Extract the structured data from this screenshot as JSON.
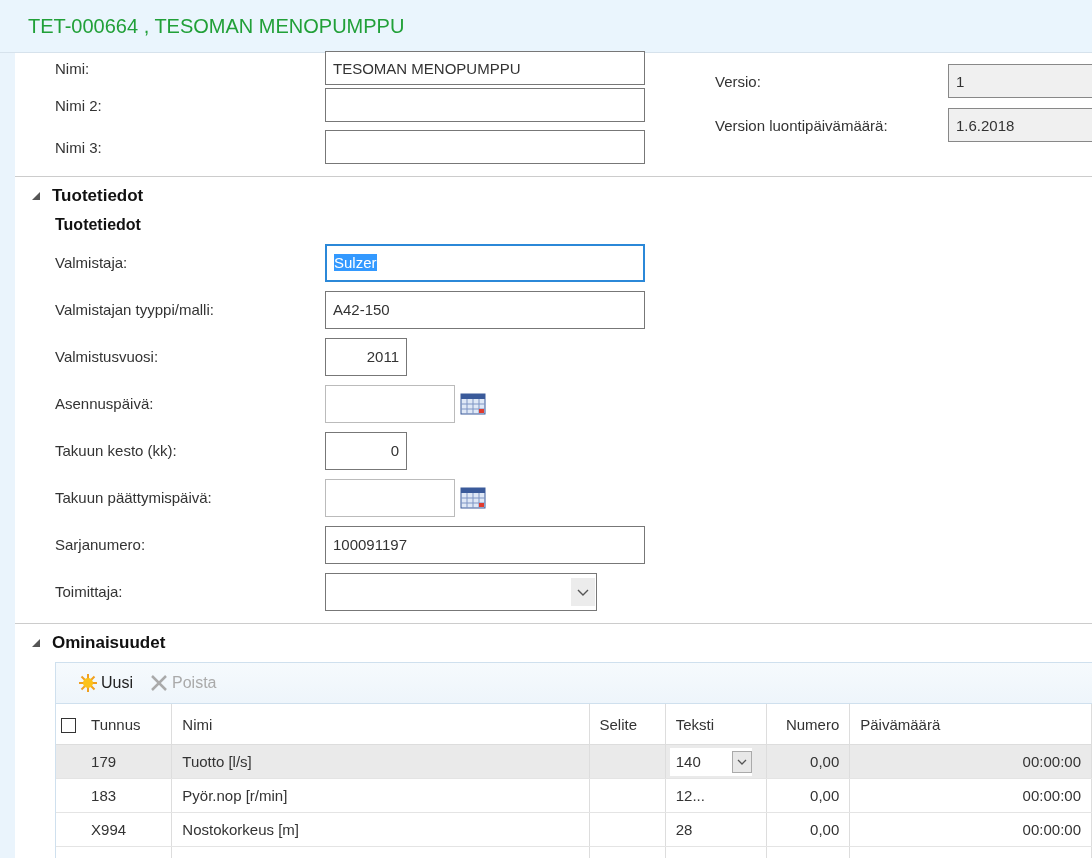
{
  "window": {
    "title": "TET-000664 , TESOMAN MENOPUMPPU"
  },
  "general": {
    "fields": [
      {
        "label": "Nimi:",
        "value": "TESOMAN MENOPUMPPU"
      },
      {
        "label": "Nimi 2:"
      },
      {
        "label": "Nimi 3:"
      }
    ],
    "version_fields": [
      {
        "label": "Versio:",
        "value": "1",
        "kind": "readonly"
      },
      {
        "label": "Version luontipäivämäärä:",
        "value": "1.6.2018",
        "kind": "readonly"
      }
    ]
  },
  "product_section": {
    "title": "Tuotetiedot",
    "expanded": true,
    "group_title": "Tuotetiedot",
    "fields": [
      {
        "label": "Valmistaja:",
        "value": "Sulzer",
        "kind": "text",
        "focused": true
      },
      {
        "label": "Valmistajan tyyppi/malli:",
        "value": "A42-150",
        "kind": "text",
        "focused": false
      },
      {
        "label": "Valmistusvuosi:",
        "value": "2011",
        "kind": "number",
        "focused": false
      },
      {
        "label": "Asennuspäivä:",
        "kind": "date",
        "focused": false
      },
      {
        "label": "Takuun kesto (kk):",
        "value": "0",
        "kind": "number",
        "focused": false
      },
      {
        "label": "Takuun päättymispäivä:",
        "kind": "date",
        "focused": false
      },
      {
        "label": "Sarjanumero:",
        "value": "100091197",
        "kind": "text",
        "focused": false
      },
      {
        "label": "Toimittaja:",
        "kind": "dropdown",
        "focused": false
      }
    ]
  },
  "properties_section": {
    "title": "Ominaisuudet",
    "expanded": true,
    "toolbar": [
      {
        "label": "Uusi",
        "disabled": false,
        "kind": "new"
      },
      {
        "label": "Poista",
        "disabled": true,
        "kind": "delete"
      }
    ],
    "table": {
      "select_all": {
        "checked": false
      },
      "columns": [
        "Tunnus",
        "Nimi",
        "Selite",
        "Teksti",
        "Numero",
        "Päivämäärä"
      ],
      "rows": [
        {
          "selected": true,
          "tunnus": "179",
          "nimi": "Tuotto [l/s]",
          "teksti": "140",
          "kind": "dropdown",
          "numero": "0,00",
          "paivamaara": "00:00:00"
        },
        {
          "selected": false,
          "tunnus": "183",
          "nimi": "Pyör.nop [r/min]",
          "teksti": "12...",
          "kind": "text",
          "numero": "0,00",
          "paivamaara": "00:00:00"
        },
        {
          "selected": false,
          "tunnus": "X994",
          "nimi": "Nostokorkeus  [m]",
          "teksti": "28",
          "kind": "text",
          "numero": "0,00",
          "paivamaara": "00:00:00"
        }
      ]
    }
  }
}
